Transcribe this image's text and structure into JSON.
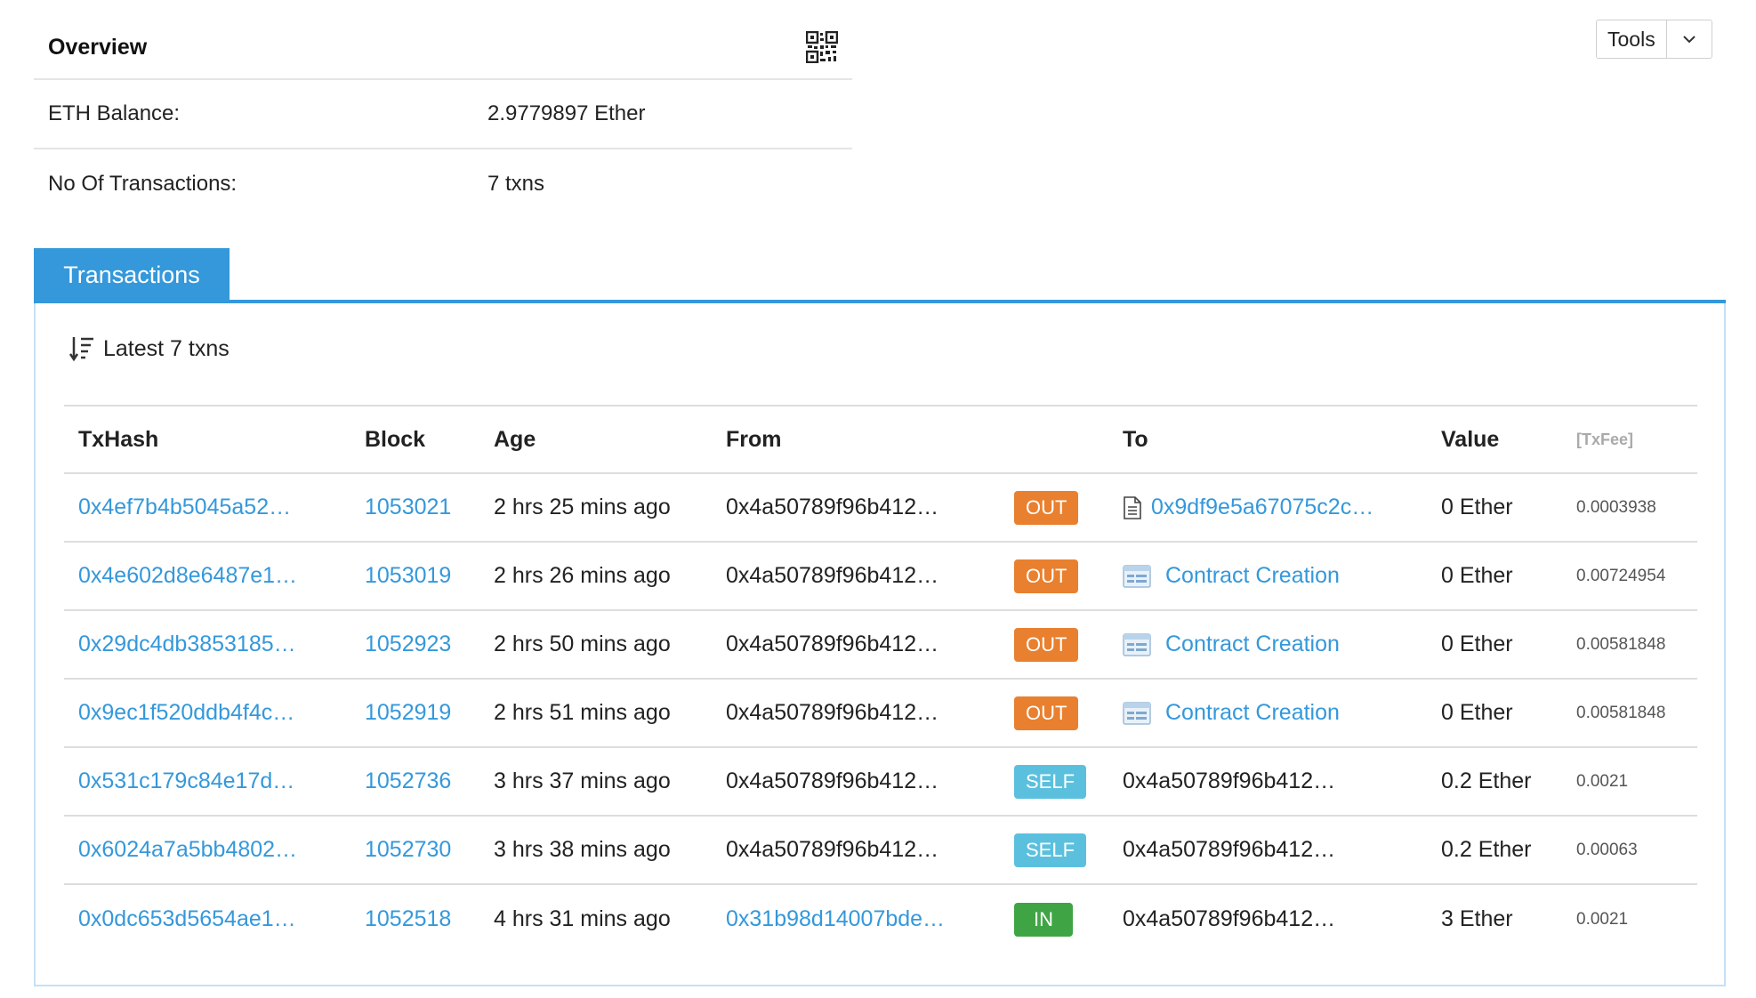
{
  "overview": {
    "title": "Overview",
    "balance_label": "ETH Balance:",
    "balance_value": "2.9779897 Ether",
    "txcount_label": "No Of Transactions:",
    "txcount_value": "7 txns"
  },
  "tools": {
    "label": "Tools"
  },
  "tab": {
    "label": "Transactions"
  },
  "latest": {
    "label": "Latest 7 txns"
  },
  "table": {
    "headers": {
      "txhash": "TxHash",
      "block": "Block",
      "age": "Age",
      "from": "From",
      "to": "To",
      "value": "Value",
      "fee": "[TxFee]"
    },
    "rows": [
      {
        "hash": "0x4ef7b4b5045a52…",
        "block": "1053021",
        "age": "2 hrs 25 mins ago",
        "from": "0x4a50789f96b412…",
        "dir": "OUT",
        "to": "0x9df9e5a67075c2c…",
        "value": "0 Ether",
        "fee": "0.0003938"
      },
      {
        "hash": "0x4e602d8e6487e1…",
        "block": "1053019",
        "age": "2 hrs 26 mins ago",
        "from": "0x4a50789f96b412…",
        "dir": "OUT",
        "to": "Contract Creation",
        "value": "0 Ether",
        "fee": "0.00724954"
      },
      {
        "hash": "0x29dc4db3853185…",
        "block": "1052923",
        "age": "2 hrs 50 mins ago",
        "from": "0x4a50789f96b412…",
        "dir": "OUT",
        "to": "Contract Creation",
        "value": "0 Ether",
        "fee": "0.00581848"
      },
      {
        "hash": "0x9ec1f520ddb4f4c…",
        "block": "1052919",
        "age": "2 hrs 51 mins ago",
        "from": "0x4a50789f96b412…",
        "dir": "OUT",
        "to": "Contract Creation",
        "value": "0 Ether",
        "fee": "0.00581848"
      },
      {
        "hash": "0x531c179c84e17d…",
        "block": "1052736",
        "age": "3 hrs 37 mins ago",
        "from": "0x4a50789f96b412…",
        "dir": "SELF",
        "to": "0x4a50789f96b412…",
        "value": "0.2 Ether",
        "fee": "0.0021"
      },
      {
        "hash": "0x6024a7a5bb4802…",
        "block": "1052730",
        "age": "3 hrs 38 mins ago",
        "from": "0x4a50789f96b412…",
        "dir": "SELF",
        "to": "0x4a50789f96b412…",
        "value": "0.2 Ether",
        "fee": "0.00063"
      },
      {
        "hash": "0x0dc653d5654ae1…",
        "block": "1052518",
        "age": "4 hrs 31 mins ago",
        "from": "0x31b98d14007bde…",
        "dir": "IN",
        "to": "0x4a50789f96b412…",
        "value": "3 Ether",
        "fee": "0.0021"
      }
    ]
  },
  "colors": {
    "link": "#3498db",
    "tab": "#3498db",
    "badge_out": "#e8802f",
    "badge_self": "#5bc0de",
    "badge_in": "#3fa544"
  },
  "icons": {
    "qr": "qr-code-icon",
    "sort": "sort-descending-icon",
    "tools_caret": "chevron-down-icon",
    "contract_doc": "document-icon",
    "contract_creation": "contract-creation-icon"
  }
}
